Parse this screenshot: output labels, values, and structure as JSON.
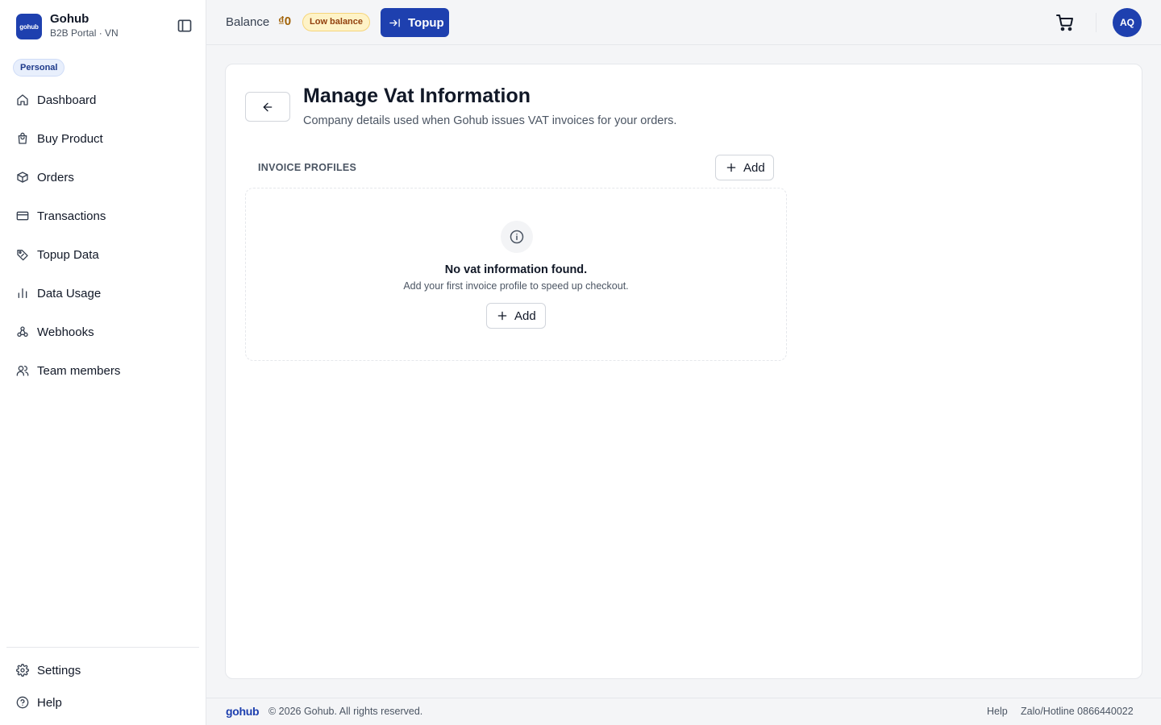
{
  "brand": {
    "logo_text": "gohub",
    "name": "Gohub",
    "subtitle": "B2B Portal · VN"
  },
  "workspace_badge": "Personal",
  "nav": [
    {
      "label": "Dashboard",
      "icon": "home-icon"
    },
    {
      "label": "Buy Product",
      "icon": "shopping-bag-icon"
    },
    {
      "label": "Orders",
      "icon": "package-icon"
    },
    {
      "label": "Transactions",
      "icon": "credit-card-icon"
    },
    {
      "label": "Topup Data",
      "icon": "tag-data-icon"
    },
    {
      "label": "Data Usage",
      "icon": "bar-chart-icon"
    },
    {
      "label": "Webhooks",
      "icon": "webhook-icon"
    },
    {
      "label": "Team members",
      "icon": "users-icon"
    }
  ],
  "bottom_nav": [
    {
      "label": "Settings",
      "icon": "gear-icon"
    },
    {
      "label": "Help",
      "icon": "help-circle-icon"
    }
  ],
  "topbar": {
    "balance_label": "Balance",
    "balance_amount": "₫0",
    "low_balance_badge": "Low balance",
    "topup_label": "Topup",
    "avatar_initials": "AQ"
  },
  "page": {
    "title": "Manage Vat Information",
    "subtitle": "Company details used when Gohub issues VAT invoices for your orders.",
    "section_label": "INVOICE PROFILES",
    "add_label": "Add",
    "empty_title": "No vat information found.",
    "empty_subtitle": "Add your first invoice profile to speed up checkout.",
    "empty_add_label": "Add"
  },
  "footer": {
    "logo_text": "gohub",
    "copyright": "© 2026 Gohub. All rights reserved.",
    "help": "Help",
    "hotline": "Zalo/Hotline 0866440022"
  },
  "colors": {
    "accent": "#1e40af",
    "balance": "#a16207",
    "badge_bg": "#fef3c7"
  }
}
